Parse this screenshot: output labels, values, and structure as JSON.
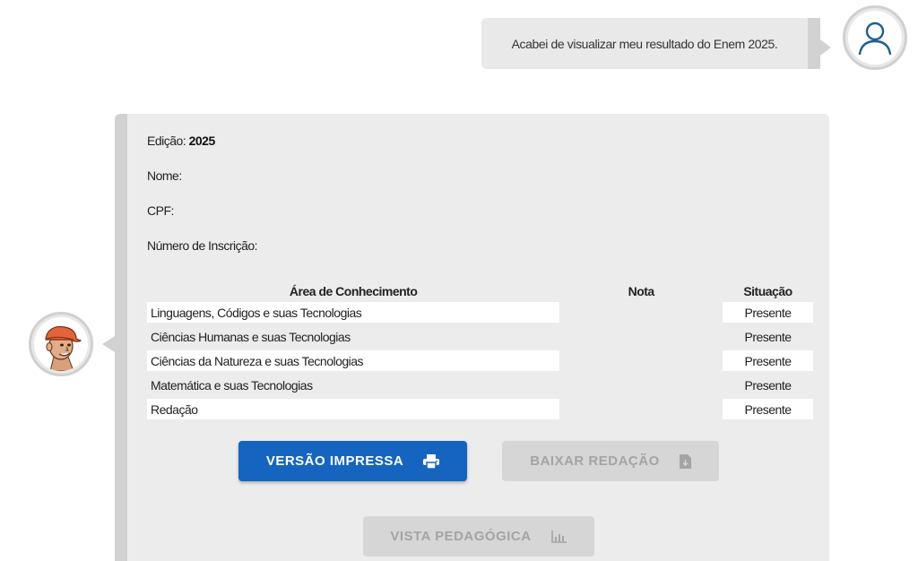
{
  "user_message": {
    "text": "Acabei de visualizar meu resultado do Enem 2025.",
    "avatar_icon": "user-icon"
  },
  "bot_message": {
    "avatar_icon": "cartoon-character-avatar",
    "edicao": {
      "label": "Edição:",
      "value": "2025"
    },
    "nome": {
      "label": "Nome:",
      "value": ""
    },
    "cpf": {
      "label": "CPF:",
      "value": ""
    },
    "inscricao": {
      "label": "Número de Inscrição:",
      "value": ""
    },
    "table": {
      "headers": {
        "area": "Área de Conhecimento",
        "nota": "Nota",
        "situacao": "Situação"
      },
      "rows": [
        {
          "area": "Linguagens, Códigos e suas Tecnologias",
          "nota": "",
          "situacao": "Presente"
        },
        {
          "area": "Ciências Humanas e suas Tecnologias",
          "nota": "",
          "situacao": "Presente"
        },
        {
          "area": "Ciências da Natureza e suas Tecnologias",
          "nota": "",
          "situacao": "Presente"
        },
        {
          "area": "Matemática e suas Tecnologias",
          "nota": "",
          "situacao": "Presente"
        },
        {
          "area": "Redação",
          "nota": "",
          "situacao": "Presente"
        }
      ]
    },
    "buttons": {
      "print": {
        "label": "VERSÃO IMPRESSA",
        "icon": "printer-icon",
        "enabled": true
      },
      "download": {
        "label": "BAIXAR REDAÇÃO",
        "icon": "file-download-icon",
        "enabled": false
      },
      "vista": {
        "label": "VISTA PEDAGÓGICA",
        "icon": "bar-chart-icon",
        "enabled": false
      }
    }
  },
  "colors": {
    "primary": "#1565c0",
    "bubble": "#ececec",
    "bubble_edge": "#d2d2d2",
    "disabled_bg": "#d6d6d6",
    "disabled_text": "#a4a4a4"
  }
}
